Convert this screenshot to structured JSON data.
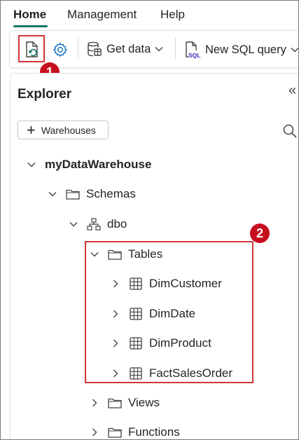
{
  "tabs": [
    {
      "label": "Home",
      "active": true
    },
    {
      "label": "Management",
      "active": false
    },
    {
      "label": "Help",
      "active": false
    }
  ],
  "toolbar": {
    "refresh_icon": "refresh-file-icon",
    "settings_icon": "gear-icon",
    "get_data_label": "Get data",
    "new_sql_query_label": "New SQL query",
    "sql_icon_text": "SQL"
  },
  "callouts": {
    "one": "1",
    "two": "2"
  },
  "explorer": {
    "title": "Explorer",
    "collapse_glyph": "«",
    "add_warehouses_label": "Warehouses"
  },
  "tree": {
    "warehouse": "myDataWarehouse",
    "schemas": "Schemas",
    "dbo": "dbo",
    "tables": "Tables",
    "table_items": [
      "DimCustomer",
      "DimDate",
      "DimProduct",
      "FactSalesOrder"
    ],
    "views": "Views",
    "functions": "Functions"
  },
  "colors": {
    "accent": "#117865",
    "highlight": "#d13438",
    "badge": "#c50f1f",
    "settings_icon": "#0f6cbd"
  }
}
